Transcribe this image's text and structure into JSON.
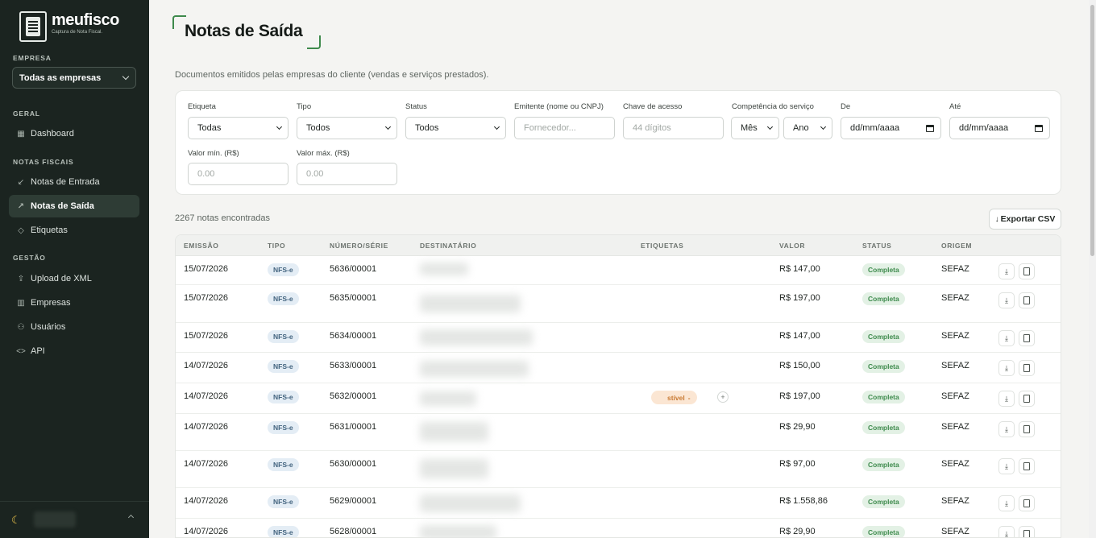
{
  "sidebar": {
    "brand": {
      "name": "meufisco",
      "tagline": "Captura de Nota Fiscal."
    },
    "company_label": "EMPRESA",
    "company_value": "Todas as empresas",
    "sections": [
      {
        "label": "GERAL",
        "items": [
          {
            "label": "Dashboard",
            "icon": "grid-icon"
          }
        ]
      },
      {
        "label": "NOTAS FISCAIS",
        "items": [
          {
            "label": "Notas de Entrada",
            "icon": "arrow-down-left-icon"
          },
          {
            "label": "Notas de Saída",
            "icon": "arrow-up-right-icon",
            "active": true
          },
          {
            "label": "Etiquetas",
            "icon": "tag-icon"
          }
        ]
      },
      {
        "label": "GESTÃO",
        "items": [
          {
            "label": "Upload de XML",
            "icon": "upload-icon"
          },
          {
            "label": "Empresas",
            "icon": "building-icon"
          },
          {
            "label": "Usuários",
            "icon": "users-icon"
          },
          {
            "label": "API",
            "icon": "code-icon"
          }
        ]
      }
    ]
  },
  "page": {
    "title": "Notas de Saída",
    "description": "Documentos emitidos pelas empresas do cliente (vendas e serviços prestados)."
  },
  "filters": {
    "etiqueta": {
      "label": "Etiqueta",
      "value": "Todas"
    },
    "tipo": {
      "label": "Tipo",
      "value": "Todos"
    },
    "status": {
      "label": "Status",
      "value": "Todos"
    },
    "emitente": {
      "label": "Emitente (nome ou CNPJ)",
      "placeholder": "Fornecedor..."
    },
    "chave": {
      "label": "Chave de acesso",
      "placeholder": "44 dígitos"
    },
    "competencia": {
      "label": "Competência do serviço",
      "month": "Mês",
      "year": "Ano"
    },
    "de": {
      "label": "De",
      "placeholder": "dd/mm/aaaa"
    },
    "ate": {
      "label": "Até",
      "placeholder": "dd/mm/aaaa"
    },
    "valor_min": {
      "label": "Valor mín. (R$)",
      "placeholder": "0.00"
    },
    "valor_max": {
      "label": "Valor máx. (R$)",
      "placeholder": "0.00"
    }
  },
  "results": {
    "count_text": "2267 notas encontradas",
    "export_label": "Exportar CSV",
    "export_icon": "download-arrow-icon"
  },
  "table": {
    "columns": [
      "EMISSÃO",
      "TIPO",
      "NÚMERO/SÉRIE",
      "DESTINATÁRIO",
      "ETIQUETAS",
      "VALOR",
      "STATUS",
      "ORIGEM"
    ],
    "rows": [
      {
        "emissao": "15/07/2026",
        "tipo": "NFS-e",
        "numero": "5636/00001",
        "valor": "R$ 147,00",
        "status": "Completa",
        "origem": "SEFAZ"
      },
      {
        "emissao": "15/07/2026",
        "tipo": "NFS-e",
        "numero": "5635/00001",
        "valor": "R$ 197,00",
        "status": "Completa",
        "origem": "SEFAZ"
      },
      {
        "emissao": "15/07/2026",
        "tipo": "NFS-e",
        "numero": "5634/00001",
        "valor": "R$ 147,00",
        "status": "Completa",
        "origem": "SEFAZ"
      },
      {
        "emissao": "14/07/2026",
        "tipo": "NFS-e",
        "numero": "5633/00001",
        "valor": "R$ 150,00",
        "status": "Completa",
        "origem": "SEFAZ"
      },
      {
        "emissao": "14/07/2026",
        "tipo": "NFS-e",
        "numero": "5632/00001",
        "valor": "R$ 197,00",
        "status": "Completa",
        "origem": "SEFAZ",
        "etiqueta": "stível",
        "etiqueta_remove": "-",
        "etiqueta_add": "+"
      },
      {
        "emissao": "14/07/2026",
        "tipo": "NFS-e",
        "numero": "5631/00001",
        "valor": "R$ 29,90",
        "status": "Completa",
        "origem": "SEFAZ"
      },
      {
        "emissao": "14/07/2026",
        "tipo": "NFS-e",
        "numero": "5630/00001",
        "valor": "R$ 97,00",
        "status": "Completa",
        "origem": "SEFAZ"
      },
      {
        "emissao": "14/07/2026",
        "tipo": "NFS-e",
        "numero": "5629/00001",
        "valor": "R$ 1.558,86",
        "status": "Completa",
        "origem": "SEFAZ"
      },
      {
        "emissao": "14/07/2026",
        "tipo": "NFS-e",
        "numero": "5628/00001",
        "valor": "R$ 29,90",
        "status": "Completa",
        "origem": "SEFAZ"
      }
    ]
  },
  "icons": {
    "theme": "moon-icon",
    "row_download": "download-icon",
    "row_document": "document-icon"
  },
  "colors": {
    "sidebar_bg": "#1b2420",
    "accent_green": "#3e8a4c",
    "status_green_bg": "#e3f1e5",
    "tipo_blue_bg": "#e4edf5",
    "tag_orange_bg": "#fbe6d3"
  }
}
